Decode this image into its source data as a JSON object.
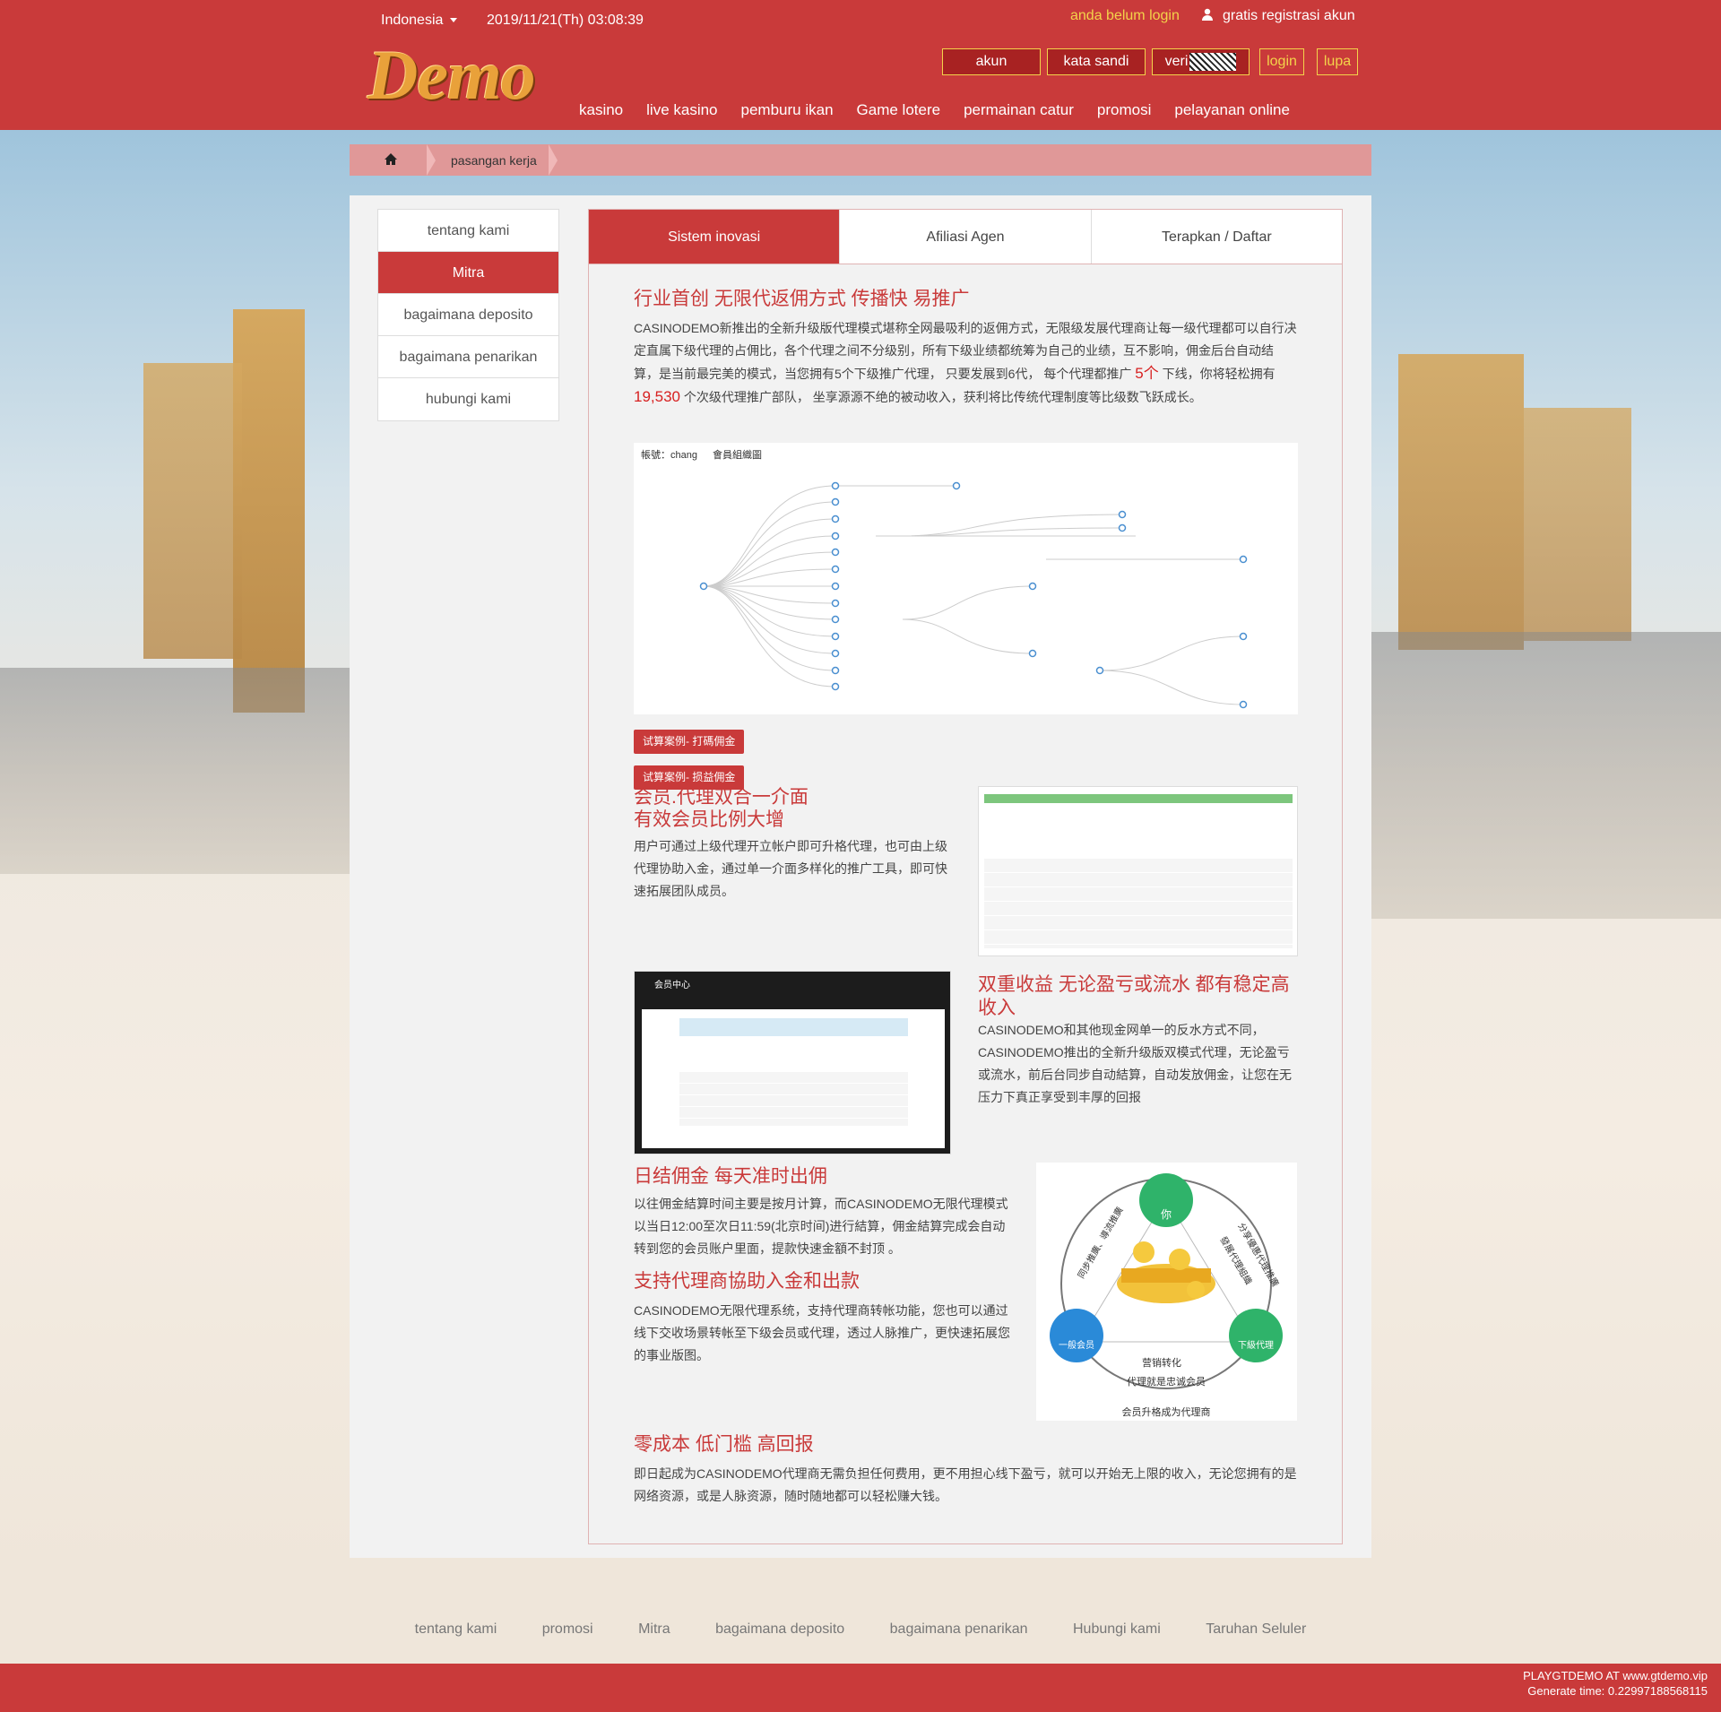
{
  "header": {
    "language": "Indonesia",
    "datetime": "2019/11/21(Th) 03:08:39",
    "not_logged_in": "anda belum login",
    "register": "gratis registrasi akun",
    "logo_text": "Demo",
    "account_label": "akun",
    "password_label": "kata sandi",
    "verify_label": "veri",
    "login_label": "login",
    "forgot_label": "lupa"
  },
  "nav": {
    "items": [
      "kasino",
      "live kasino",
      "pemburu ikan",
      "Game lotere",
      "permainan catur",
      "promosi",
      "pelayanan online"
    ]
  },
  "breadcrumb": {
    "current": "pasangan kerja"
  },
  "sidebar": {
    "items": [
      {
        "label": "tentang kami",
        "active": false
      },
      {
        "label": "Mitra",
        "active": true
      },
      {
        "label": "bagaimana deposito",
        "active": false
      },
      {
        "label": "bagaimana penarikan",
        "active": false
      },
      {
        "label": "hubungi kami",
        "active": false
      }
    ]
  },
  "tabs": [
    {
      "label": "Sistem inovasi",
      "active": true
    },
    {
      "label": "Afiliasi Agen",
      "active": false
    },
    {
      "label": "Terapkan / Daftar",
      "active": false
    }
  ],
  "content": {
    "s1_title": "行业首创 无限代返佣方式 传播快 易推广",
    "s1_text_a": "CASINODEMO新推出的全新升级版代理模式堪称全网最吸利的返佣方式，无限级发展代理商让每一级代理都可以自行决定直属下级代理的占佣比，各个代理之间不分级别，所有下级业绩都统筹为自己的业绩，互不影响，佣金后台自动结算，是当前最完美的模式，当您拥有5个下级推广代理， 只要发展到6代， 每个代理都推广 ",
    "s1_hl_a": "5个",
    "s1_text_b": " 下线，你将轻松拥有 ",
    "s1_hl_b": "19,530",
    "s1_text_c": " 个次级代理推广部队， 坐享源源不绝的被动收入，获利将比传统代理制度等比级数飞跃成长。",
    "tree_account": "帳號：chang",
    "tree_legend": "會員組織圖",
    "btn1": "试算案例- 打碼佣金",
    "btn2": "试算案例- 损益佣金",
    "s2_title_1": "会员.代理双合一介面",
    "s2_title_2": "有效会员比例大增",
    "s2_text": "用户可通过上级代理开立帐户即可升格代理，也可由上级代理协助入金，通过单一介面多样化的推广工具，即可快速拓展团队成员。",
    "s3_title": "双重收益 无论盈亏或流水 都有稳定高收入",
    "s3_text": "CASINODEMO和其他现金网单一的反水方式不同，CASINODEMO推出的全新升级版双模式代理，无论盈亏或流水，前后台同步自动結算，自动发放佣金，让您在无压力下真正享受到丰厚的回报",
    "s3_img_title": "会员中心",
    "s4_title": "日结佣金 每天准时出佣",
    "s4_text": "以往佣金結算时间主要是按月计算，而CASINODEMO无限代理模式以当日12:00至次日11:59(北京时间)进行結算，佣金結算完成会自动转到您的会员账户里面，提款快速金額不封顶 。",
    "s5_title": "支持代理商協助入金和出款",
    "s5_text": "CASINODEMO无限代理系统，支持代理商转帐功能，您也可以通过线下交收场景转帐至下级会员或代理，透过人脉推广，更快速拓展您的事业版图。",
    "s6_title": "零成本 低门槛 高回报",
    "s6_text": "即日起成为CASINODEMO代理商无需负担任何费用，更不用担心线下盈亏，就可以开始无上限的收入，无论您拥有的是网络资源，或是人脉资源，随时随地都可以轻松赚大钱。",
    "circle_you": "你",
    "circle_member": "一般会员",
    "circle_sub": "下級代理",
    "circle_left": "同步推廣、導流推廣",
    "circle_right": "分享優惠代理推廣",
    "circle_right2": "發展代理組織",
    "circle_center1": "营销转化",
    "circle_center2": "代理就是忠诚会员",
    "circle_bottom": "会员升格成为代理商"
  },
  "footer": {
    "links": [
      "tentang kami",
      "promosi",
      "Mitra",
      "bagaimana deposito",
      "bagaimana penarikan",
      "Hubungi kami",
      "Taruhan Seluler"
    ],
    "brand": "PLAYGTDEMO AT www.gtdemo.vip",
    "gen_time": "Generate time: 0.22997188568115"
  },
  "colors": {
    "brand_red": "#c93a3a",
    "accent_yellow": "#f3d34a",
    "highlight_red": "#d72020"
  }
}
